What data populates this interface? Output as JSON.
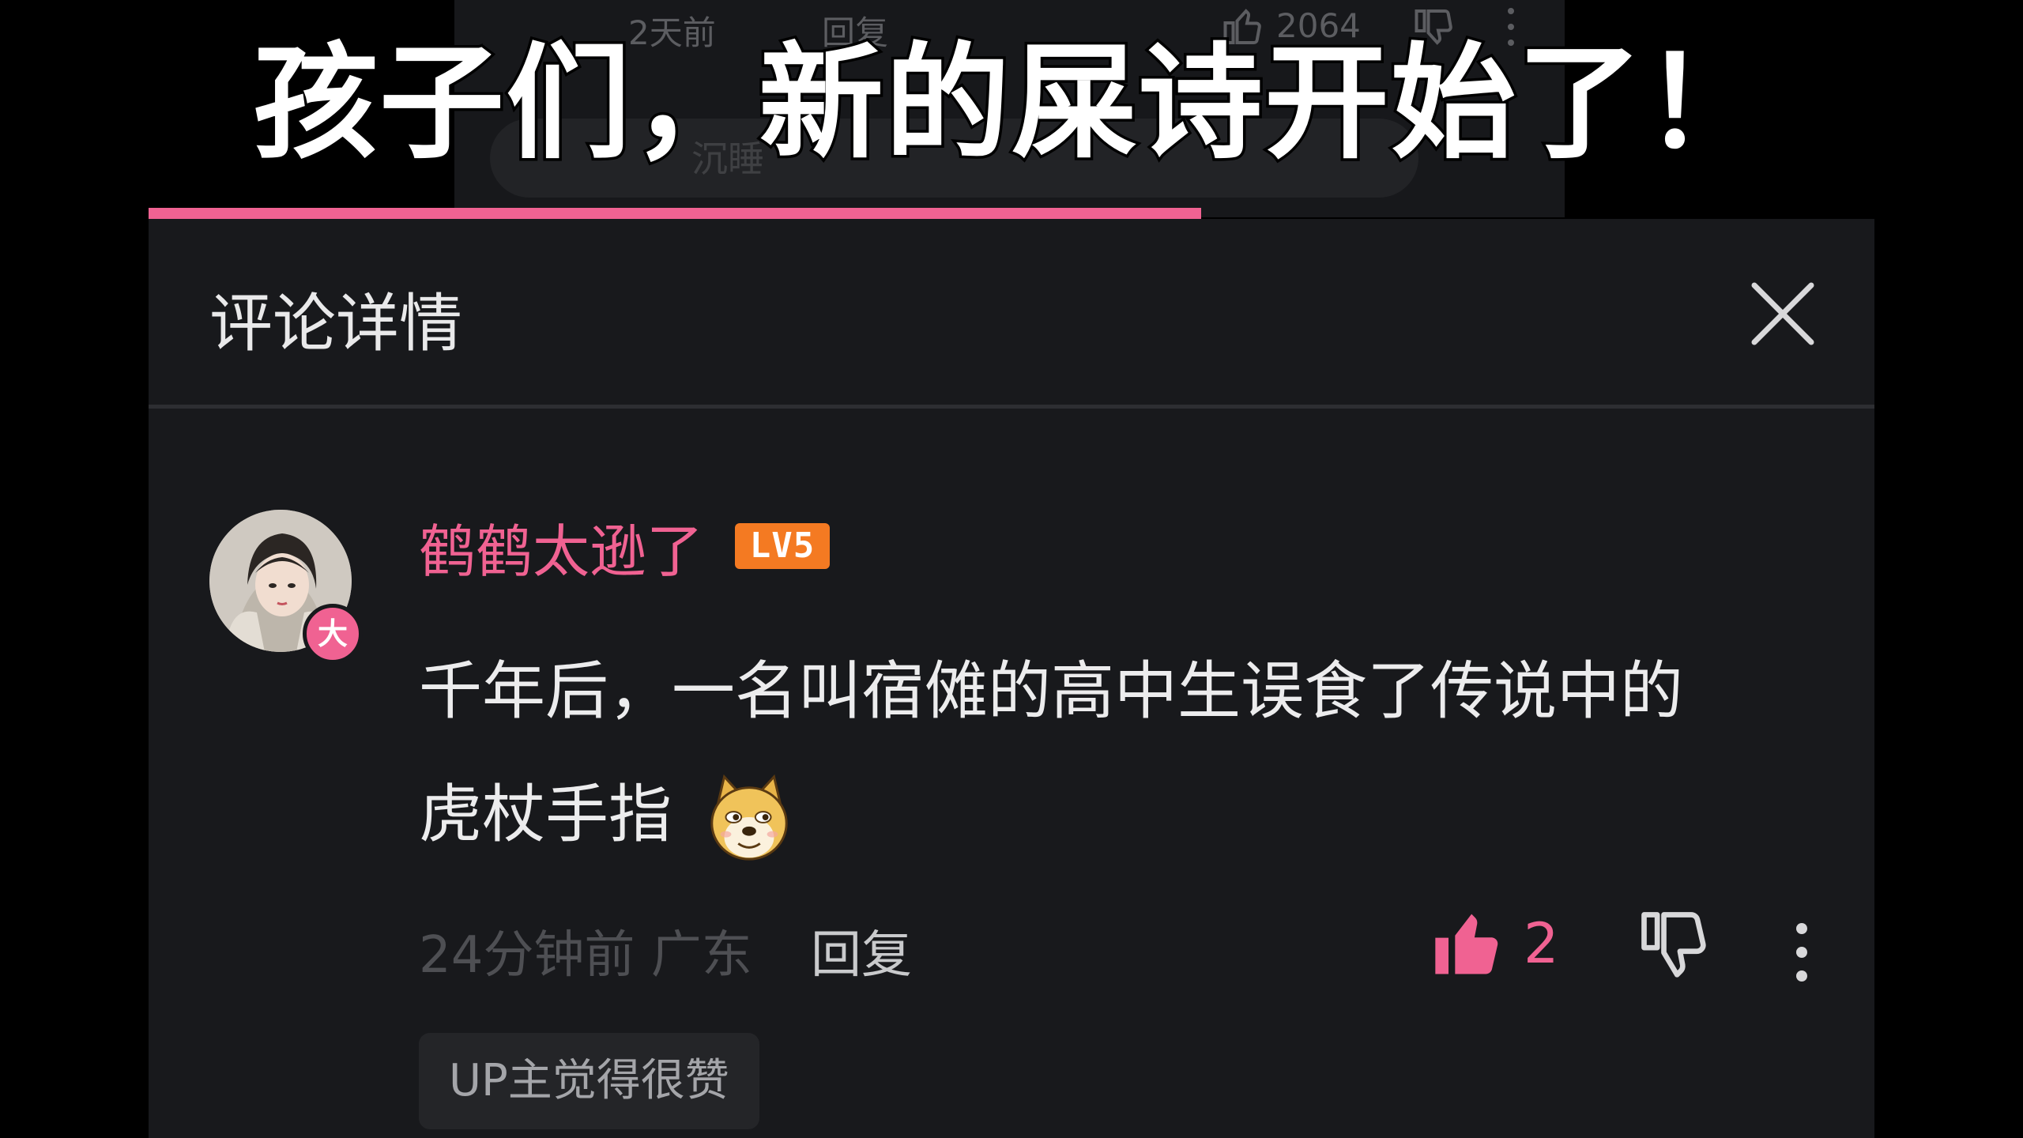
{
  "video": {
    "caption": "孩子们，新的屎诗开始了！",
    "progress_percent": 61
  },
  "background_comment": {
    "time": "2天前",
    "reply_label": "回复",
    "like_count": "2064",
    "input_text": "沉睡"
  },
  "panel": {
    "title": "评论详情",
    "close_icon": "close-icon"
  },
  "comment": {
    "username": "鹤鹤太逊了",
    "level": "LV5",
    "avatar_badge": "大",
    "text_line1": "千年后，一名叫宿傩的高中生误食了传说中的",
    "text_line2": "虎杖手指",
    "emoji": "doge-emoji",
    "time_location": "24分钟前 广东",
    "reply_label": "回复",
    "like_count": "2",
    "up_tag": "UP主觉得很赞"
  },
  "colors": {
    "accent_pink": "#f06292",
    "level_orange": "#f47a22",
    "panel_bg": "#18191c"
  }
}
